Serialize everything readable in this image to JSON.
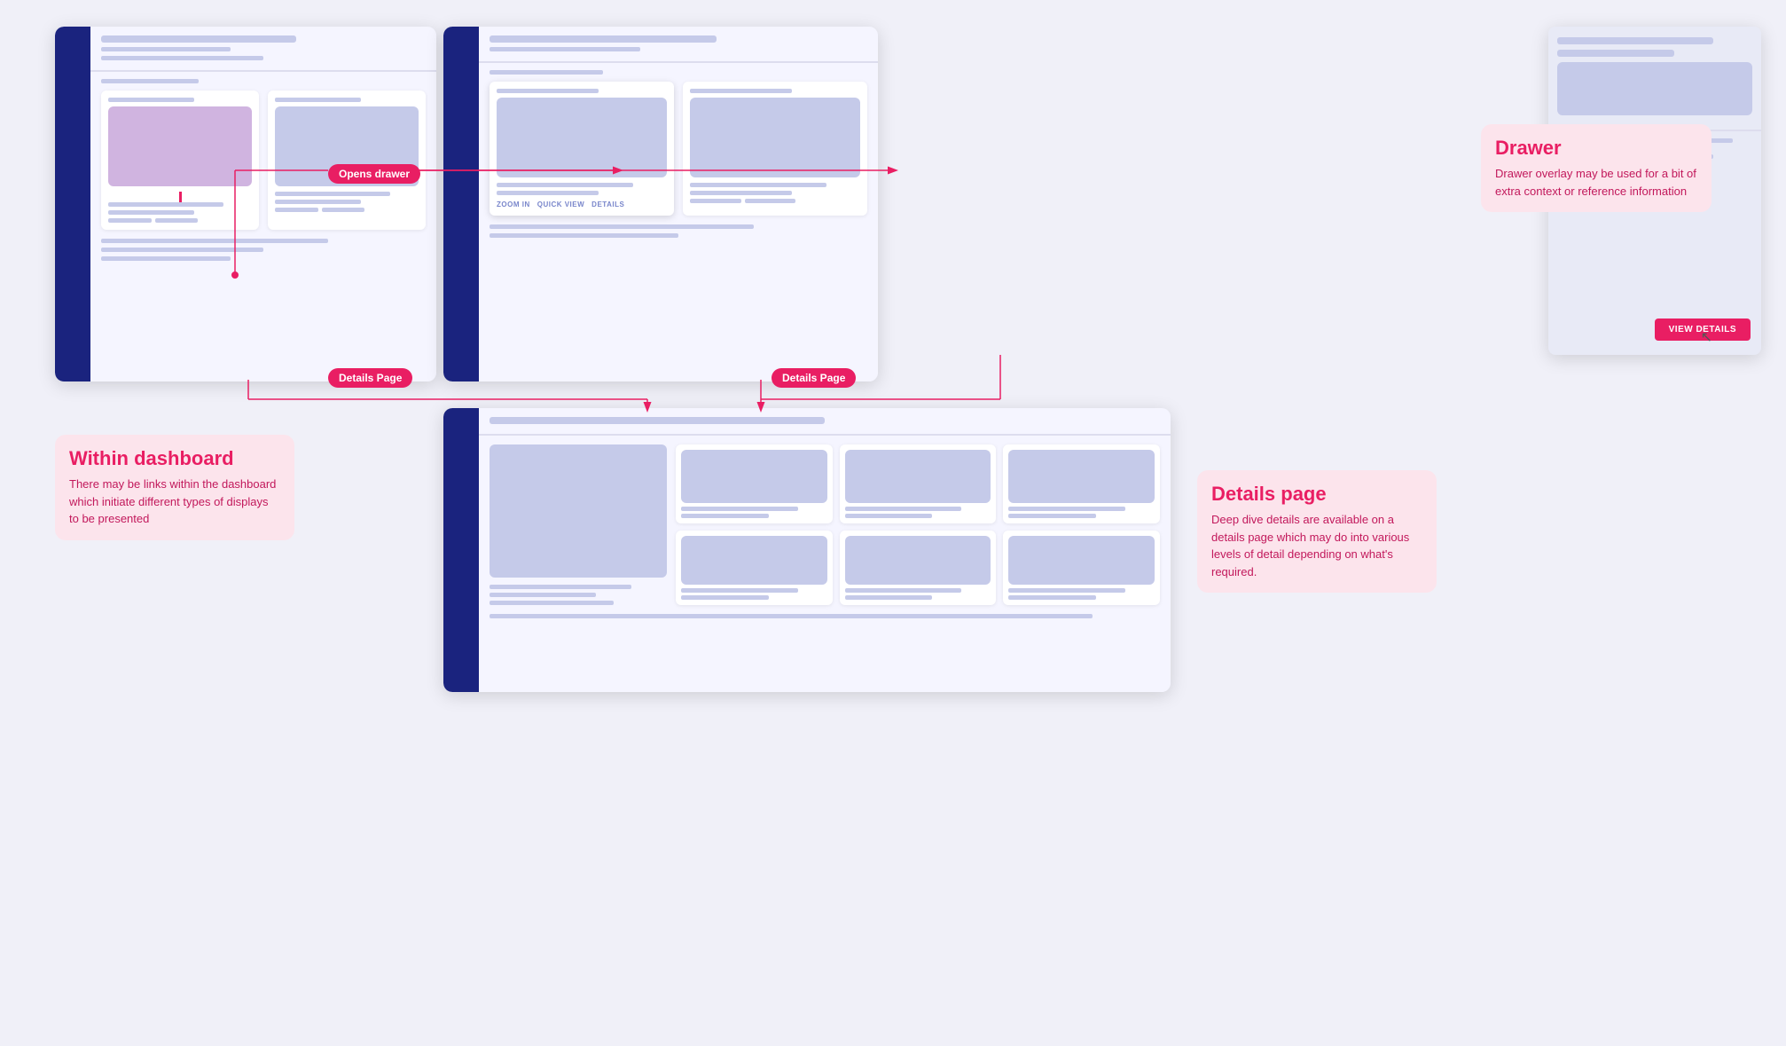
{
  "annotations": {
    "drawer": {
      "title": "Drawer",
      "body": "Drawer overlay may be used for a bit of extra context or reference information"
    },
    "within_dashboard": {
      "title": "Within dashboard",
      "body": "There may be links within the dashboard which initiate different types of displays to be presented"
    },
    "details_page": {
      "title": "Details page",
      "body": "Deep dive details are available on a details page which may do into various levels of detail depending on what's required."
    }
  },
  "labels": {
    "opens_drawer": "Opens drawer",
    "details_page_1": "Details Page",
    "details_page_2": "Details Page",
    "view_details": "VIEW DETAILS",
    "zoom_in": "ZOOM IN",
    "quick_view": "QUICK VIEW",
    "details": "DETAILS"
  }
}
